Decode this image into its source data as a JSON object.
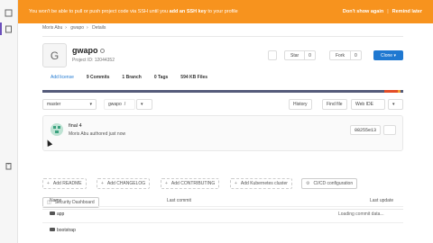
{
  "banner": {
    "message_start": "You won't be able to pull or push project code via SSH until you ",
    "message_bold": "add an SSH key",
    "message_end": " to your profile",
    "dont_show": "Don't show again",
    "remind_later": "Remind later",
    "separator": "|"
  },
  "breadcrumb": [
    "Moris Abu",
    "gwapo",
    "Details"
  ],
  "project": {
    "avatar_letter": "G",
    "name": "gwapo",
    "id_text": "Project ID: 12044352",
    "star_label": "Star",
    "star_count": "0",
    "fork_label": "Fork",
    "fork_count": "0",
    "clone_label": "Clone ▾"
  },
  "stats": {
    "add_license": "Add license",
    "commits": "9 Commits",
    "branch": "1 Branch",
    "tags": "0 Tags",
    "files": "594 KB Files"
  },
  "repo_bar": {
    "branch": "master",
    "path": "gwapo",
    "path_sep": "/",
    "history": "History",
    "find_file": "Find file",
    "web_ide": "Web IDE"
  },
  "commit": {
    "title": "final 4",
    "meta": "Moris Abu authored just now",
    "sha": "08255e13"
  },
  "quick_actions": [
    "Add README",
    "Add CHANGELOG",
    "Add CONTRIBUTING",
    "Add Kubernetes cluster",
    "CI/CD configuration",
    "Security Dashboard"
  ],
  "table": {
    "col_name": "Name",
    "col_last_commit": "Last commit",
    "col_last_update": "Last update",
    "rows": [
      {
        "name": "app",
        "status": "Loading commit data..."
      },
      {
        "name": "bootstrap",
        "status": ""
      }
    ]
  },
  "colors": {
    "banner": "#f7931e",
    "clone": "#1f78d1",
    "link": "#1f78d1"
  }
}
